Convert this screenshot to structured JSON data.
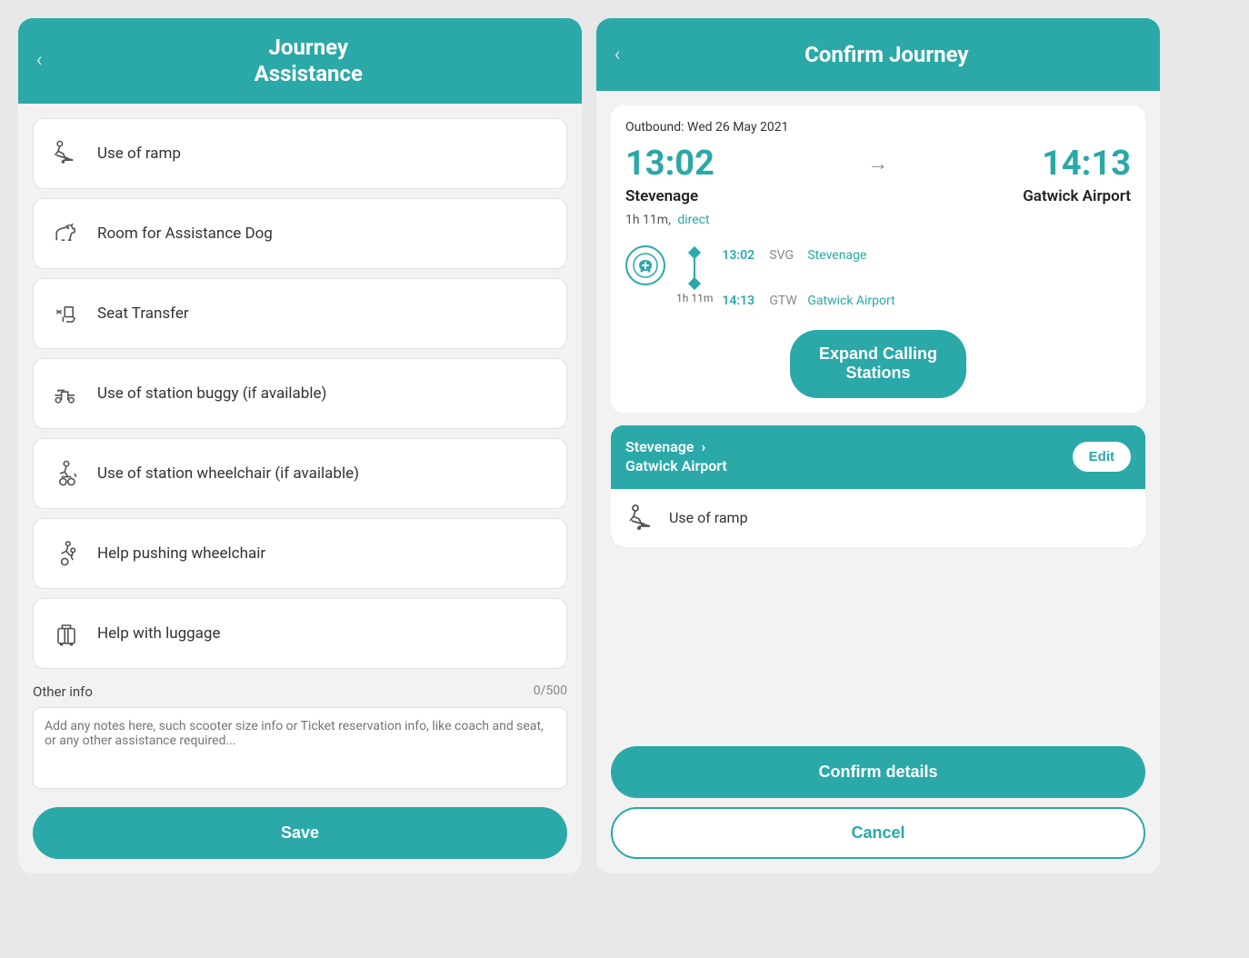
{
  "leftPanel": {
    "header": {
      "back": "‹",
      "title": "Journey\nAssistance"
    },
    "items": [
      {
        "id": "ramp",
        "label": "Use of ramp"
      },
      {
        "id": "dog",
        "label": "Room for Assistance Dog"
      },
      {
        "id": "seat",
        "label": "Seat Transfer"
      },
      {
        "id": "buggy",
        "label": "Use of station buggy (if available)"
      },
      {
        "id": "wheelchair-station",
        "label": "Use of station wheelchair (if available)"
      },
      {
        "id": "push",
        "label": "Help pushing wheelchair"
      },
      {
        "id": "luggage",
        "label": "Help with luggage"
      }
    ],
    "otherInfo": {
      "label": "Other info",
      "count": "0/500",
      "placeholder": "Add any notes here, such scooter size info or Ticket reservation info, like coach and seat, or any other assistance required..."
    },
    "saveButton": "Save"
  },
  "rightPanel": {
    "header": {
      "back": "‹",
      "title": "Confirm Journey"
    },
    "outbound": "Outbound:",
    "date": "Wed 26 May 2021",
    "departTime": "13:02",
    "arriveTime": "14:13",
    "departStation": "Stevenage",
    "arriveStation": "Gatwick Airport",
    "duration": "1h 11m,",
    "durationLink": "direct",
    "stops": [
      {
        "time": "13:02",
        "code": "SVG",
        "name": "Stevenage"
      },
      {
        "time": "14:13",
        "code": "GTW",
        "name": "Gatwick Airport"
      }
    ],
    "stopDuration": "1h 11m",
    "expandButton": "Expand Calling\nStations",
    "routeFrom": "Stevenage",
    "routeArrow": "›",
    "routeTo": "Gatwick Airport",
    "editButton": "Edit",
    "selectedAssistance": "Use of ramp",
    "confirmButton": "Confirm details",
    "cancelButton": "Cancel"
  }
}
